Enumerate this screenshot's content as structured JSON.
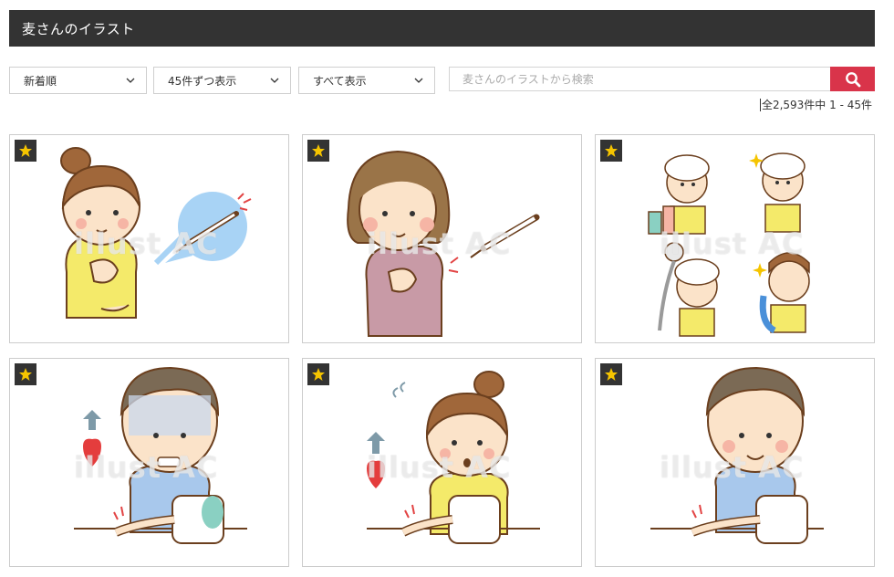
{
  "header": {
    "title": "麦さんのイラスト"
  },
  "filters": {
    "sort": "新着順",
    "per_page": "45件ずつ表示",
    "show": "すべて表示"
  },
  "search": {
    "placeholder": "麦さんのイラストから検索",
    "value": ""
  },
  "results": {
    "count_text": "全2,593件中 1 - 45件"
  },
  "cards": [
    {
      "subject": "woman receiving vaccine injection",
      "favorite_icon": "star-icon"
    },
    {
      "subject": "middle-aged woman with syringe",
      "favorite_icon": "star-icon"
    },
    {
      "subject": "girl washing hair with shampoo",
      "favorite_icon": "star-icon"
    },
    {
      "subject": "man anxious blood pressure measurement",
      "favorite_icon": "star-icon"
    },
    {
      "subject": "woman worried blood pressure measurement",
      "favorite_icon": "star-icon"
    },
    {
      "subject": "man calm blood pressure measurement",
      "favorite_icon": "star-icon"
    }
  ],
  "colors": {
    "header_bg": "#333333",
    "search_button": "#d9344a",
    "star": "#f5c400"
  }
}
